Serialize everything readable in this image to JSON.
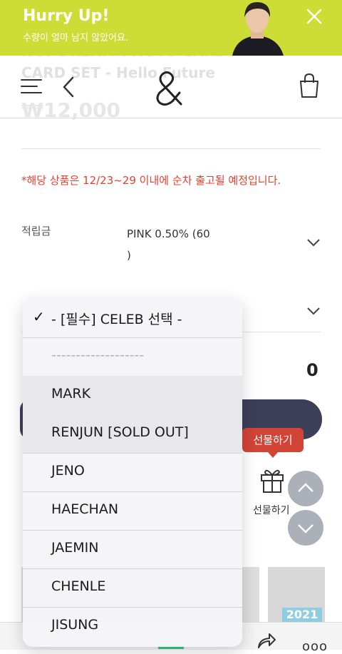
{
  "banner": {
    "title": "Hurry Up!",
    "subtitle": "수량이 얼마 남지 않았어요."
  },
  "product": {
    "title_line1": "NCT DREAM PHOTO CARD",
    "title_line2": "CARD SET - Hello Future",
    "price": "₩12,000"
  },
  "notice": "*해당 상품은 12/23~29 이내에 순차 출고될 예정입니다.",
  "mileage": {
    "label": "적립금",
    "value": "PINK 0.50% (60\n)"
  },
  "total": "0",
  "gift": {
    "tooltip": "선물하기",
    "label": "선물하기"
  },
  "thumbnail_tag": "2021",
  "dropdown": {
    "selected_index": 0,
    "options": [
      "- [필수] CELEB 선택 -",
      "-------------------",
      "MARK",
      "RENJUN [SOLD OUT]",
      "JENO",
      "HAECHAN",
      "JAEMIN",
      "CHENLE",
      "JISUNG"
    ]
  },
  "more_label": "ooo",
  "colors": {
    "banner": "#cddd36",
    "notice": "#e8402f",
    "buy_button": "#3c3f58",
    "gift_tooltip": "#d34438"
  }
}
